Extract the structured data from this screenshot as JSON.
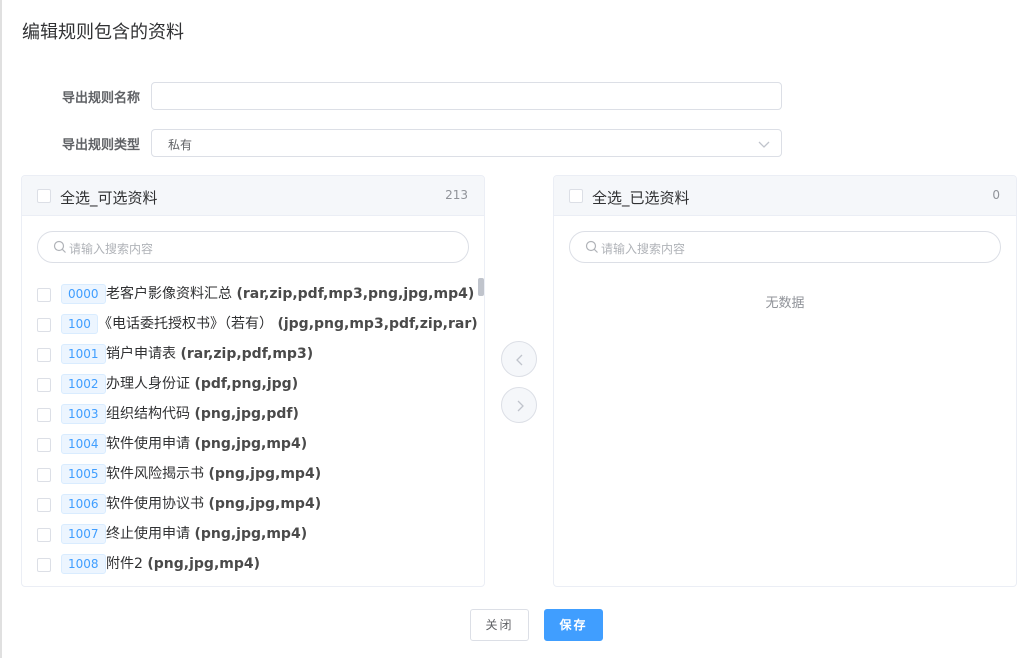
{
  "dialog": {
    "title": "编辑规则包含的资料"
  },
  "form": {
    "name_label": "导出规则名称",
    "name_value": "",
    "type_label": "导出规则类型",
    "type_value": "私有"
  },
  "left_panel": {
    "title": "全选_可选资料",
    "count": "213",
    "search_placeholder": "请输入搜索内容",
    "items": [
      {
        "code": "0000",
        "name": "老客户影像资料汇总",
        "formats": "(rar,zip,pdf,mp3,png,jpg,mp4)"
      },
      {
        "code": "100",
        "name": "《电话委托授权书》（若有）",
        "formats": "(jpg,png,mp3,pdf,zip,rar)"
      },
      {
        "code": "1001",
        "name": "销户申请表",
        "formats": "(rar,zip,pdf,mp3)"
      },
      {
        "code": "1002",
        "name": "办理人身份证",
        "formats": "(pdf,png,jpg)"
      },
      {
        "code": "1003",
        "name": "组织结构代码",
        "formats": "(png,jpg,pdf)"
      },
      {
        "code": "1004",
        "name": "软件使用申请",
        "formats": "(png,jpg,mp4)"
      },
      {
        "code": "1005",
        "name": "软件风险揭示书",
        "formats": "(png,jpg,mp4)"
      },
      {
        "code": "1006",
        "name": "软件使用协议书",
        "formats": "(png,jpg,mp4)"
      },
      {
        "code": "1007",
        "name": "终止使用申请",
        "formats": "(png,jpg,mp4)"
      },
      {
        "code": "1008",
        "name": "附件2",
        "formats": "(png,jpg,mp4)"
      }
    ]
  },
  "right_panel": {
    "title": "全选_已选资料",
    "count": "0",
    "search_placeholder": "请输入搜索内容",
    "empty_text": "无数据"
  },
  "buttons": {
    "close": "关闭",
    "save": "保存"
  },
  "colors": {
    "primary": "#409eff",
    "tag_bg": "#ecf5ff",
    "border": "#dcdfe6"
  },
  "icons": [
    "search-icon",
    "chevron-down-icon",
    "chevron-left-icon",
    "chevron-right-icon"
  ]
}
